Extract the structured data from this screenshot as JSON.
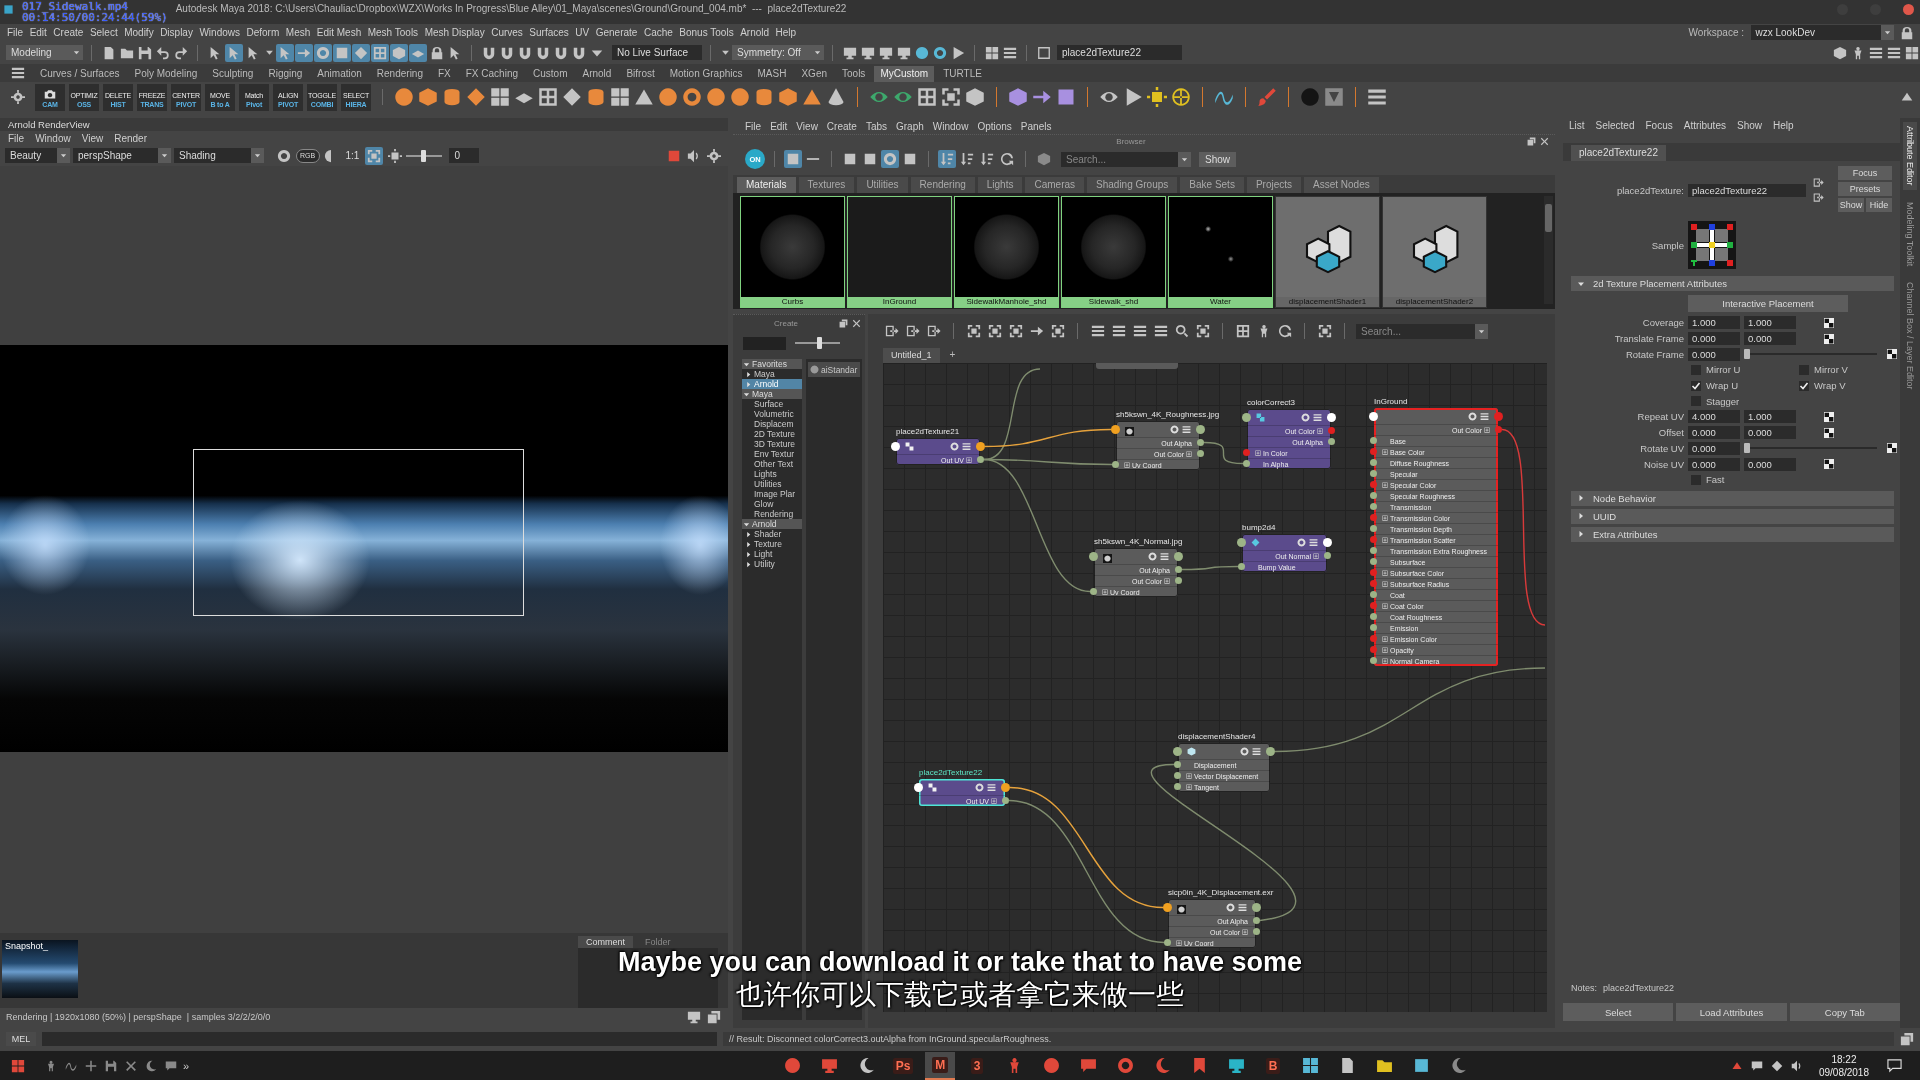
{
  "video_overlay": {
    "file": "017_Sidewalk.mp4",
    "time": "00:14:50/00:24:44(59%)"
  },
  "window": {
    "title": "Autodesk Maya 2018: C:\\Users\\Chauliac\\Dropbox\\WZX\\Works In Progress\\Blue Alley\\01_Maya\\scenes\\Ground\\Ground_004.mb*  ---  place2dTexture22"
  },
  "menu_bar": [
    "File",
    "Edit",
    "Create",
    "Select",
    "Modify",
    "Display",
    "Windows",
    "Deform",
    "Mesh",
    "Edit Mesh",
    "Mesh Tools",
    "Mesh Display",
    "Curves",
    "Surfaces",
    "UV",
    "Generate",
    "Cache",
    "Bonus Tools",
    "Arnold",
    "Help"
  ],
  "workspace": {
    "label": "Workspace :",
    "value": "wzx LookDev"
  },
  "status_line": {
    "mode": "Modeling",
    "select_modes": [
      {
        "on": false
      },
      {
        "on": true
      },
      {
        "on": false
      }
    ],
    "masks": [
      {
        "on": true
      },
      {
        "on": true
      },
      {
        "on": true
      },
      {
        "on": true
      },
      {
        "on": true
      },
      {
        "on": true
      },
      {
        "on": true
      },
      {
        "on": true
      }
    ],
    "live_surface": "No Live Surface",
    "symmetry": "Symmetry: Off",
    "selection": "place2dTexture22"
  },
  "shelf": {
    "tabs": [
      {
        "label": "Curves / Surfaces",
        "selected": false
      },
      {
        "label": "Poly Modeling",
        "selected": false
      },
      {
        "label": "Sculpting",
        "selected": false
      },
      {
        "label": "Rigging",
        "selected": false
      },
      {
        "label": "Animation",
        "selected": false
      },
      {
        "label": "Rendering",
        "selected": false
      },
      {
        "label": "FX",
        "selected": false
      },
      {
        "label": "FX Caching",
        "selected": false
      },
      {
        "label": "Custom",
        "selected": false
      },
      {
        "label": "Arnold",
        "selected": false
      },
      {
        "label": "Bifrost",
        "selected": false
      },
      {
        "label": "Motion Graphics",
        "selected": false
      },
      {
        "label": "MASH",
        "selected": false
      },
      {
        "label": "XGen",
        "selected": false
      },
      {
        "label": "Tools",
        "selected": false
      },
      {
        "label": "MyCustom",
        "selected": true
      },
      {
        "label": "TURTLE",
        "selected": false
      }
    ],
    "buttons": [
      {
        "kind": "camera",
        "bottom": "CAM"
      },
      {
        "kind": "text",
        "top": "OPTIMIZ",
        "bottom": "OSS"
      },
      {
        "kind": "text",
        "top": "DELETE",
        "bottom": "HIST"
      },
      {
        "kind": "text",
        "top": "FREEZE",
        "bottom": "TRANS"
      },
      {
        "kind": "text",
        "top": "CENTER",
        "bottom": "PIVOT"
      },
      {
        "kind": "text",
        "top": "MOVE",
        "bottom": "B to A"
      },
      {
        "kind": "text",
        "top": "Match",
        "bottom": "Pivot"
      },
      {
        "kind": "text",
        "top": "ALIGN",
        "bottom": "PIVOT"
      },
      {
        "kind": "text",
        "top": "TOGGLE",
        "bottom": "COMBI"
      },
      {
        "kind": "text",
        "top": "SELECT",
        "bottom": "HIERA"
      }
    ]
  },
  "render_view": {
    "title": "Arnold RenderView",
    "menu": [
      "File",
      "Window",
      "View",
      "Render"
    ],
    "aov": "Beauty",
    "camera": "perspShape",
    "display": "Shading",
    "channels": "RGB",
    "zoom": "1:1",
    "region": {
      "on": true
    },
    "exposure_slider": {
      "level": 0.5
    },
    "exposure": "0",
    "snapshot": "Snapshot_",
    "comment_tabs": [
      {
        "label": "Comment",
        "selected": true
      },
      {
        "label": "Folder",
        "selected": false
      }
    ],
    "status": "Rendering | 1920x1080 (50%) | perspShape  | samples 3/2/2/2/0/0"
  },
  "hypershade": {
    "menu": [
      "File",
      "Edit",
      "View",
      "Create",
      "Tabs",
      "Graph",
      "Window",
      "Options",
      "Panels"
    ],
    "browser": {
      "title": "Browser",
      "toggle": {
        "label": "ON",
        "on": true
      },
      "toggles": [
        {
          "on": true
        },
        {
          "on": false
        },
        {
          "on": false
        },
        {
          "on": false
        },
        {
          "on": true
        },
        {
          "on": false
        },
        {
          "on": true
        },
        {
          "on": false
        },
        {
          "on": false
        },
        {
          "on": false
        },
        {
          "on": false
        }
      ],
      "search_placeholder": "Search...",
      "show": "Show",
      "tabs": [
        {
          "label": "Materials",
          "selected": true
        },
        {
          "label": "Textures",
          "selected": false
        },
        {
          "label": "Utilities",
          "selected": false
        },
        {
          "label": "Rendering",
          "selected": false
        },
        {
          "label": "Lights",
          "selected": false
        },
        {
          "label": "Cameras",
          "selected": false
        },
        {
          "label": "Shading Groups",
          "selected": false
        },
        {
          "label": "Bake Sets",
          "selected": false
        },
        {
          "label": "Projects",
          "selected": false
        },
        {
          "label": "Asset Nodes",
          "selected": false
        }
      ],
      "swatches": [
        {
          "label": "Curbs",
          "kind": "sphere",
          "selected": true
        },
        {
          "label": "InGround",
          "kind": "flat",
          "selected": true
        },
        {
          "label": "SidewalkManhole_shd",
          "kind": "sphere",
          "selected": true
        },
        {
          "label": "Sidewalk_shd",
          "kind": "sphere",
          "selected": true
        },
        {
          "label": "Water",
          "kind": "water",
          "selected": true
        },
        {
          "label": "displacementShader1",
          "kind": "displacement",
          "selected": false
        },
        {
          "label": "displacementShader2",
          "kind": "displacement",
          "selected": false
        }
      ]
    }
  },
  "create_panel": {
    "title": "Create",
    "icon_size": {
      "level": 0.55
    },
    "tree": [
      {
        "label": "Favorites",
        "expanded": true,
        "selected": false,
        "children": [
          {
            "label": "Maya",
            "kind": "branch",
            "expanded": false,
            "selected": false
          },
          {
            "label": "Arnold",
            "kind": "branch",
            "expanded": false,
            "selected": true
          }
        ]
      },
      {
        "label": "Maya",
        "expanded": true,
        "selected": false,
        "children": [
          {
            "label": "Surface",
            "kind": "leaf",
            "selected": false
          },
          {
            "label": "Volumetric",
            "kind": "leaf",
            "selected": false
          },
          {
            "label": "Displacem",
            "kind": "leaf",
            "selected": false
          },
          {
            "label": "2D Texture",
            "kind": "leaf",
            "selected": false
          },
          {
            "label": "3D Texture",
            "kind": "leaf",
            "selected": false
          },
          {
            "label": "Env Textur",
            "kind": "leaf",
            "selected": false
          },
          {
            "label": "Other Text",
            "kind": "leaf",
            "selected": false
          },
          {
            "label": "Lights",
            "kind": "leaf",
            "selected": false
          },
          {
            "label": "Utilities",
            "kind": "leaf",
            "selected": false
          },
          {
            "label": "Image Plar",
            "kind": "leaf",
            "selected": false
          },
          {
            "label": "Glow",
            "kind": "leaf",
            "selected": false
          },
          {
            "label": "Rendering",
            "kind": "leaf",
            "selected": false
          }
        ]
      },
      {
        "label": "Arnold",
        "expanded": true,
        "selected": false,
        "children": [
          {
            "label": "Shader",
            "kind": "branch",
            "expanded": false,
            "selected": false
          },
          {
            "label": "Texture",
            "kind": "branch",
            "expanded": false,
            "selected": false
          },
          {
            "label": "Light",
            "kind": "branch",
            "expanded": false,
            "selected": false
          },
          {
            "label": "Utility",
            "kind": "branch",
            "expanded": false,
            "selected": false
          }
        ]
      }
    ],
    "node_types": [
      "aiStandar"
    ]
  },
  "node_editor": {
    "tab": "Untitled_1",
    "add_tab": "+",
    "search_placeholder": "Search...",
    "nodes": [
      {
        "title": "place2dTexture21",
        "kind": "placement",
        "selected": false,
        "highlighted": false,
        "inlet": {
          "color": "#ffffff"
        },
        "outlet": {
          "color": "#f0a020"
        },
        "ports": [
          {
            "label": "Out UV",
            "kind": "out",
            "color": "#9db487",
            "compound": true
          }
        ]
      },
      {
        "title": "sh5kswn_4K_Roughness.jpg",
        "kind": "texture",
        "selected": false,
        "highlighted": false,
        "inlet": {
          "color": "#f0a020"
        },
        "outlet": {
          "color": "#9db487"
        },
        "ports": [
          {
            "label": "Out Alpha",
            "kind": "out",
            "color": "#9db487",
            "compound": false
          },
          {
            "label": "Out Color",
            "kind": "out",
            "color": "#9db487",
            "compound": true
          },
          {
            "label": "Uv Coord",
            "kind": "in",
            "color": "#9db487",
            "compound": true
          }
        ]
      },
      {
        "title": "colorCorrect3",
        "kind": "colorcorrect",
        "selected": false,
        "highlighted": false,
        "inlet": {
          "color": "#9db487"
        },
        "outlet": {
          "color": "#ffffff"
        },
        "ports": [
          {
            "label": "Out Color",
            "kind": "out",
            "color": "#e02020",
            "compound": true
          },
          {
            "label": "Out Alpha",
            "kind": "out",
            "color": "#9db487",
            "compound": false
          },
          {
            "label": "In Color",
            "kind": "in",
            "color": "#e02020",
            "compound": true
          },
          {
            "label": "In Alpha",
            "kind": "in",
            "color": "#9db487",
            "compound": false
          }
        ]
      },
      {
        "title": "InGround",
        "kind": "material",
        "selected": false,
        "highlighted": true,
        "inlet": {
          "color": "#ffffff"
        },
        "outlet": {
          "color": "#e02020"
        },
        "ports": [
          {
            "label": "Out Color",
            "kind": "out",
            "color": "#e02020",
            "compound": true
          },
          {
            "label": "Base",
            "kind": "in",
            "color": "#9db487",
            "compound": false
          },
          {
            "label": "Base Color",
            "kind": "in",
            "color": "#e02020",
            "compound": true
          },
          {
            "label": "Diffuse Roughness",
            "kind": "in",
            "color": "#9db487",
            "compound": false
          },
          {
            "label": "Specular",
            "kind": "in",
            "color": "#9db487",
            "compound": false
          },
          {
            "label": "Specular Color",
            "kind": "in",
            "color": "#e02020",
            "compound": true
          },
          {
            "label": "Specular Roughness",
            "kind": "in",
            "color": "#9db487",
            "compound": false
          },
          {
            "label": "Transmission",
            "kind": "in",
            "color": "#9db487",
            "compound": false
          },
          {
            "label": "Transmission Color",
            "kind": "in",
            "color": "#e02020",
            "compound": true
          },
          {
            "label": "Transmission Depth",
            "kind": "in",
            "color": "#9db487",
            "compound": false
          },
          {
            "label": "Transmission Scatter",
            "kind": "in",
            "color": "#e02020",
            "compound": true
          },
          {
            "label": "Transmission Extra Roughness",
            "kind": "in",
            "color": "#9db487",
            "compound": false
          },
          {
            "label": "Subsurface",
            "kind": "in",
            "color": "#9db487",
            "compound": false
          },
          {
            "label": "Subsurface Color",
            "kind": "in",
            "color": "#e02020",
            "compound": true
          },
          {
            "label": "Subsurface Radius",
            "kind": "in",
            "color": "#e02020",
            "compound": true
          },
          {
            "label": "Coat",
            "kind": "in",
            "color": "#9db487",
            "compound": false
          },
          {
            "label": "Coat Color",
            "kind": "in",
            "color": "#e02020",
            "compound": true
          },
          {
            "label": "Coat Roughness",
            "kind": "in",
            "color": "#9db487",
            "compound": false
          },
          {
            "label": "Emission",
            "kind": "in",
            "color": "#9db487",
            "compound": false
          },
          {
            "label": "Emission Color",
            "kind": "in",
            "color": "#e02020",
            "compound": true
          },
          {
            "label": "Opacity",
            "kind": "in",
            "color": "#e02020",
            "compound": true
          },
          {
            "label": "Normal Camera",
            "kind": "in",
            "color": "#9db487",
            "compound": true
          }
        ]
      },
      {
        "title": "bump2d4",
        "kind": "bump",
        "selected": false,
        "highlighted": false,
        "inlet": {
          "color": "#9db487"
        },
        "outlet": {
          "color": "#ffffff"
        },
        "ports": [
          {
            "label": "Out Normal",
            "kind": "out",
            "color": "#9db487",
            "compound": true
          },
          {
            "label": "Bump Value",
            "kind": "in",
            "color": "#9db487",
            "compound": false
          }
        ]
      },
      {
        "title": "sh5kswn_4K_Normal.jpg",
        "kind": "texture",
        "selected": false,
        "highlighted": false,
        "inlet": {
          "color": "#9db487"
        },
        "outlet": {
          "color": "#9db487"
        },
        "ports": [
          {
            "label": "Out Alpha",
            "kind": "out",
            "color": "#9db487",
            "compound": false
          },
          {
            "label": "Out Color",
            "kind": "out",
            "color": "#9db487",
            "compound": true
          },
          {
            "label": "Uv Coord",
            "kind": "in",
            "color": "#9db487",
            "compound": true
          }
        ]
      },
      {
        "title": "displacementShader4",
        "kind": "displacement",
        "selected": false,
        "highlighted": false,
        "inlet": {
          "color": "#9db487"
        },
        "outlet": {
          "color": "#9db487"
        },
        "ports": [
          {
            "label": "Displacement",
            "kind": "in",
            "color": "#9db487",
            "compound": false
          },
          {
            "label": "Vector Displacement",
            "kind": "in",
            "color": "#9db487",
            "compound": true
          },
          {
            "label": "Tangent",
            "kind": "in",
            "color": "#9db487",
            "compound": true
          }
        ]
      },
      {
        "title": "place2dTexture22",
        "kind": "placement",
        "selected": true,
        "highlighted": false,
        "inlet": {
          "color": "#ffffff"
        },
        "outlet": {
          "color": "#f0a020"
        },
        "ports": [
          {
            "label": "Out UV",
            "kind": "out",
            "color": "#9db487",
            "compound": true
          }
        ]
      },
      {
        "title": "sicp0in_4K_Displacement.exr",
        "kind": "texture",
        "selected": false,
        "highlighted": false,
        "inlet": {
          "color": "#f0a020"
        },
        "outlet": {
          "color": "#9db487"
        },
        "ports": [
          {
            "label": "Out Alpha",
            "kind": "out",
            "color": "#9db487",
            "compound": false
          },
          {
            "label": "Out Color",
            "kind": "out",
            "color": "#9db487",
            "compound": true
          },
          {
            "label": "Uv Coord",
            "kind": "in",
            "color": "#9db487",
            "compound": true
          }
        ]
      }
    ],
    "wires": [
      {
        "color": "#7f8c6e"
      },
      {
        "color": "#e6a23c"
      },
      {
        "color": "#7f8c6e"
      },
      {
        "color": "#7f8c6e"
      },
      {
        "color": "#7f8c6e"
      },
      {
        "color": "#7f8c6e"
      },
      {
        "color": "#d83a3a"
      },
      {
        "color": "#7f8c6e"
      },
      {
        "color": "#e6a23c"
      },
      {
        "color": "#7f8c6e"
      },
      {
        "color": "#7f8c6e"
      }
    ]
  },
  "attribute_editor": {
    "menu": [
      "List",
      "Selected",
      "Focus",
      "Attributes",
      "Show",
      "Help"
    ],
    "tab": "place2dTexture22",
    "node_label": "place2dTexture:",
    "node_name": "place2dTexture22",
    "buttons": [
      "Focus",
      "Presets",
      "Show",
      "Hide"
    ],
    "sample_label": "Sample",
    "section": {
      "title": "2d Texture Placement Attributes",
      "expanded": true
    },
    "interactive": "Interactive Placement",
    "rows": [
      {
        "kind": "pair",
        "label": "Coverage",
        "values": [
          "1.000",
          "1.000"
        ]
      },
      {
        "kind": "pair",
        "label": "Translate Frame",
        "values": [
          "0.000",
          "0.000"
        ]
      },
      {
        "kind": "slider",
        "label": "Rotate Frame",
        "values": [
          "0.000"
        ],
        "level": 0
      },
      {
        "kind": "checks",
        "items": [
          {
            "label": "Mirror U",
            "checked": false
          },
          {
            "label": "Mirror V",
            "checked": false
          }
        ]
      },
      {
        "kind": "checks",
        "items": [
          {
            "label": "Wrap U",
            "checked": true
          },
          {
            "label": "Wrap V",
            "checked": true
          }
        ]
      },
      {
        "kind": "checks",
        "items": [
          {
            "label": "Stagger",
            "checked": false
          }
        ]
      },
      {
        "kind": "pair",
        "label": "Repeat UV",
        "values": [
          "4.000",
          "1.000"
        ]
      },
      {
        "kind": "pair",
        "label": "Offset",
        "values": [
          "0.000",
          "0.000"
        ]
      },
      {
        "kind": "slider",
        "label": "Rotate UV",
        "values": [
          "0.000"
        ],
        "level": 0
      },
      {
        "kind": "pair",
        "label": "Noise UV",
        "values": [
          "0.000",
          "0.000"
        ]
      },
      {
        "kind": "checks",
        "items": [
          {
            "label": "Fast",
            "checked": false
          }
        ]
      }
    ],
    "sections": [
      {
        "title": "Node Behavior",
        "expanded": false
      },
      {
        "title": "UUID",
        "expanded": false
      },
      {
        "title": "Extra Attributes",
        "expanded": false
      }
    ],
    "notes_label": "Notes:",
    "notes": "place2dTexture22",
    "footer": [
      "Select",
      "Load Attributes",
      "Copy Tab"
    ],
    "side_tabs": [
      {
        "label": "Attribute Editor",
        "selected": true
      },
      {
        "label": "Modeling Toolkit",
        "selected": false
      },
      {
        "label": "Channel Box / Layer Editor",
        "selected": false
      }
    ]
  },
  "command_line": {
    "language": "MEL",
    "result": "// Result: Disconnect colorCorrect3.outAlpha from InGround.specularRoughness."
  },
  "subtitles": {
    "english": "Maybe you can download it or take that to have some",
    "chinese": "也许你可以下载它或者拿它来做一些"
  },
  "taskbar": {
    "overflow": "»",
    "apps": [
      {
        "active": false
      },
      {
        "active": false
      },
      {
        "active": false
      },
      {
        "label": "Ps",
        "active": false
      },
      {
        "label": "M",
        "active": true
      },
      {
        "label": "3",
        "active": false
      },
      {
        "active": false
      },
      {
        "active": false
      },
      {
        "active": false
      },
      {
        "active": false
      },
      {
        "active": false
      },
      {
        "active": false
      },
      {
        "active": false
      },
      {
        "label": "B",
        "active": false
      },
      {
        "active": false
      },
      {
        "active": false
      },
      {
        "active": false
      },
      {
        "active": false
      },
      {
        "active": false
      }
    ],
    "time": "18:22",
    "date": "09/08/2018"
  }
}
